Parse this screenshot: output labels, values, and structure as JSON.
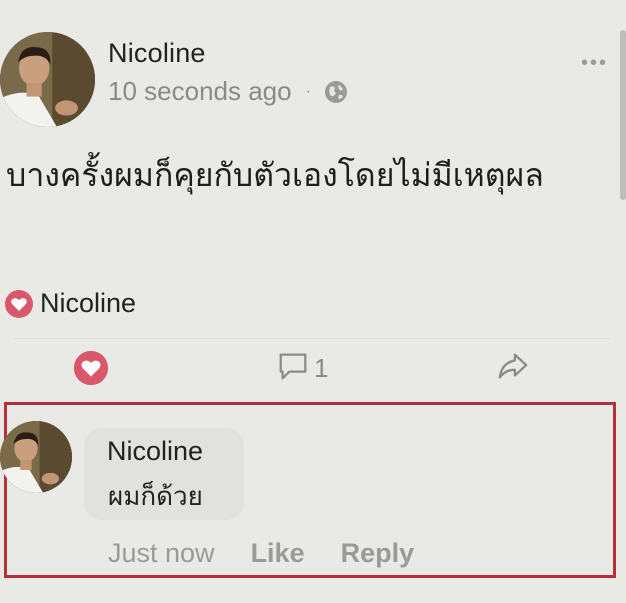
{
  "post": {
    "author": "Nicoline",
    "time": "10 seconds ago",
    "separator": "·",
    "privacy_icon": "globe-icon",
    "more_icon": "more-options-icon",
    "text": "บางครั้งผมก็คุยกับตัวเองโดยไม่มีเหตุผล"
  },
  "reactions": {
    "icon": "heart-reaction-icon",
    "name": "Nicoline"
  },
  "actions": {
    "like_icon": "heart-icon",
    "comment_icon": "comment-icon",
    "comment_count": "1",
    "share_icon": "share-icon"
  },
  "comment": {
    "author": "Nicoline",
    "text": "ผมก็ด้วย",
    "time": "Just now",
    "like_label": "Like",
    "reply_label": "Reply"
  },
  "colors": {
    "background": "#e9e9e6",
    "heart": "#d9576a",
    "highlight_border": "#b5303a"
  }
}
